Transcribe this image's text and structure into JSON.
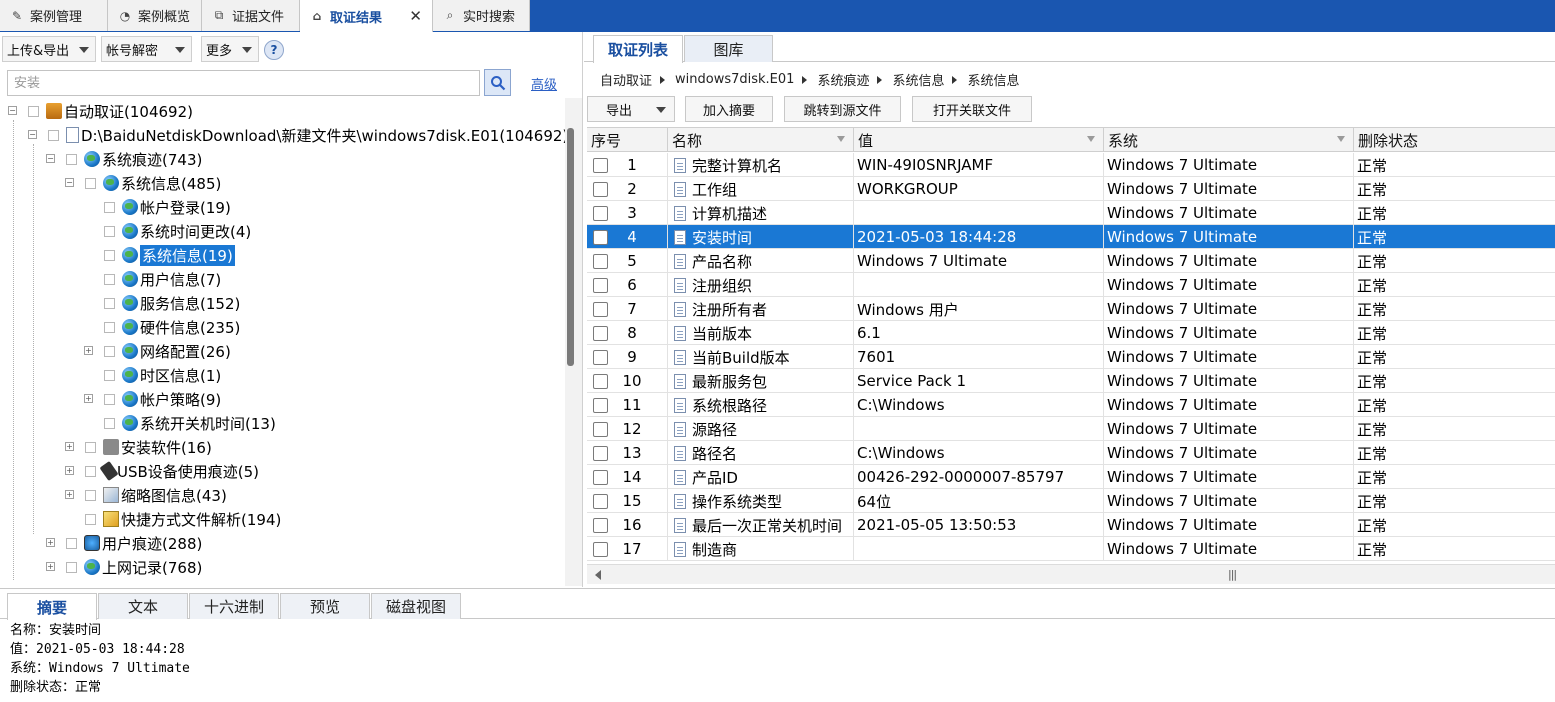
{
  "top_tabs": [
    {
      "label": "案例管理",
      "icon": "edit-icon"
    },
    {
      "label": "案例概览",
      "icon": "gauge-icon"
    },
    {
      "label": "证据文件",
      "icon": "files-icon"
    },
    {
      "label": "取证结果",
      "icon": "tag-icon",
      "active": true
    },
    {
      "label": "实时搜索",
      "icon": "search-icon"
    }
  ],
  "close_glyph": "✕",
  "left_toolbar": {
    "upload_export": "上传&导出",
    "account_decrypt": "帐号解密",
    "more": "更多",
    "help": "?"
  },
  "search": {
    "placeholder": "安装",
    "advanced": "高级"
  },
  "tree": [
    {
      "label": "自动取证(104692)"
    },
    {
      "label": "D:\\BaiduNetdiskDownload\\新建文件夹\\windows7disk.E01(104692)"
    },
    {
      "label": "系统痕迹(743)"
    },
    {
      "label": "系统信息(485)"
    },
    {
      "label": "帐户登录(19)"
    },
    {
      "label": "系统时间更改(4)"
    },
    {
      "label": "系统信息(19)",
      "selected": true
    },
    {
      "label": "用户信息(7)"
    },
    {
      "label": "服务信息(152)"
    },
    {
      "label": "硬件信息(235)"
    },
    {
      "label": "网络配置(26)"
    },
    {
      "label": "时区信息(1)"
    },
    {
      "label": "帐户策略(9)"
    },
    {
      "label": "系统开关机时间(13)"
    },
    {
      "label": "安装软件(16)"
    },
    {
      "label": "USB设备使用痕迹(5)"
    },
    {
      "label": "缩略图信息(43)"
    },
    {
      "label": "快捷方式文件解析(194)"
    },
    {
      "label": "用户痕迹(288)"
    },
    {
      "label": "上网记录(768)"
    }
  ],
  "right_tabs": [
    "取证列表",
    "图库"
  ],
  "breadcrumb": [
    "自动取证",
    "windows7disk.E01",
    "系统痕迹",
    "系统信息",
    "系统信息"
  ],
  "right_toolbar": {
    "export": "导出",
    "add_summary": "加入摘要",
    "goto_source": "跳转到源文件",
    "open_related": "打开关联文件"
  },
  "table": {
    "columns": [
      "序号",
      "名称",
      "值",
      "系统",
      "删除状态"
    ],
    "selected_index": 3,
    "rows": [
      [
        "1",
        "完整计算机名",
        "WIN-49I0SNRJAMF",
        "Windows 7 Ultimate",
        "正常"
      ],
      [
        "2",
        "工作组",
        "WORKGROUP",
        "Windows 7 Ultimate",
        "正常"
      ],
      [
        "3",
        "计算机描述",
        "",
        "Windows 7 Ultimate",
        "正常"
      ],
      [
        "4",
        "安装时间",
        "2021-05-03 18:44:28",
        "Windows 7 Ultimate",
        "正常"
      ],
      [
        "5",
        "产品名称",
        "Windows 7 Ultimate",
        "Windows 7 Ultimate",
        "正常"
      ],
      [
        "6",
        "注册组织",
        "",
        "Windows 7 Ultimate",
        "正常"
      ],
      [
        "7",
        "注册所有者",
        "Windows 用户",
        "Windows 7 Ultimate",
        "正常"
      ],
      [
        "8",
        "当前版本",
        "6.1",
        "Windows 7 Ultimate",
        "正常"
      ],
      [
        "9",
        "当前Build版本",
        "7601",
        "Windows 7 Ultimate",
        "正常"
      ],
      [
        "10",
        "最新服务包",
        "Service Pack 1",
        "Windows 7 Ultimate",
        "正常"
      ],
      [
        "11",
        "系统根路径",
        "C:\\Windows",
        "Windows 7 Ultimate",
        "正常"
      ],
      [
        "12",
        "源路径",
        "",
        "Windows 7 Ultimate",
        "正常"
      ],
      [
        "13",
        "路径名",
        "C:\\Windows",
        "Windows 7 Ultimate",
        "正常"
      ],
      [
        "14",
        "产品ID",
        "00426-292-0000007-85797",
        "Windows 7 Ultimate",
        "正常"
      ],
      [
        "15",
        "操作系统类型",
        "64位",
        "Windows 7 Ultimate",
        "正常"
      ],
      [
        "16",
        "最后一次正常关机时间",
        "2021-05-05 13:50:53",
        "Windows 7 Ultimate",
        "正常"
      ],
      [
        "17",
        "制造商",
        "",
        "Windows 7 Ultimate",
        "正常"
      ]
    ]
  },
  "bottom_tabs": [
    "摘要",
    "文本",
    "十六进制",
    "预览",
    "磁盘视图"
  ],
  "summary_lines": [
    "名称：安装时间",
    "值：2021-05-03 18:44:28",
    "系统：Windows 7 Ultimate",
    "删除状态：正常"
  ],
  "colors": {
    "accent": "#1a56b0",
    "selection": "#1a78d4",
    "link": "#2b5fc4"
  }
}
